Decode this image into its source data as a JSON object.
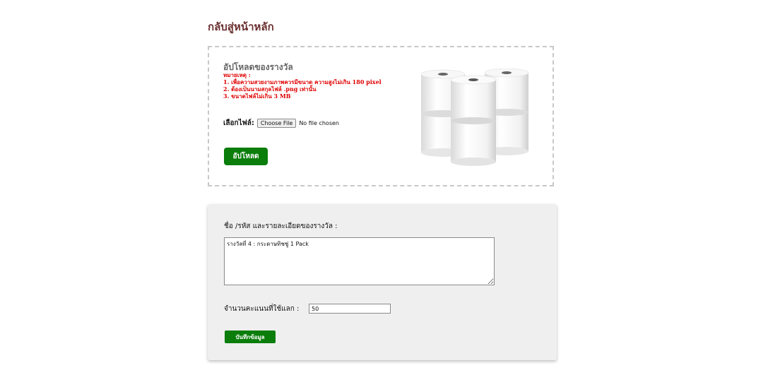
{
  "header": {
    "back_link": "กลับสู่หน้าหลัก"
  },
  "upload": {
    "title": "อัปโหลดของรางวัล",
    "note_heading": "หมายเหตุ :",
    "notes": [
      "1. เพื่อความสวยงามภาพควรมีขนาด ความสูงไม่เกิน 180 pixel",
      "2. ต้องเป็นนามสกุลไฟล์ .png เท่านั้น",
      "3. ขนาดไฟล์ไม่เกิน 3 MB"
    ],
    "file_label": "เลือกไฟล์:",
    "choose_file_button": "Choose File",
    "file_status": "No file chosen",
    "upload_button": "อัปโหลด",
    "image_icon": "toilet-paper-rolls-image"
  },
  "details": {
    "label": "ชื่อ /รหัส และรายละเอียดของรางวัล :",
    "textarea_value": "รางวัลที่ 4 : กระดาษทิชชู่ 1 Pack",
    "points_label": "จำนวนคะแนนที่ใช้แลก :",
    "points_value": "50",
    "save_button": "บันทึกข้อมูล"
  },
  "colors": {
    "back_link": "#6b2f2f",
    "note_red": "#e00000",
    "button_green": "#0a7d0a",
    "card_bg": "#efefef"
  }
}
